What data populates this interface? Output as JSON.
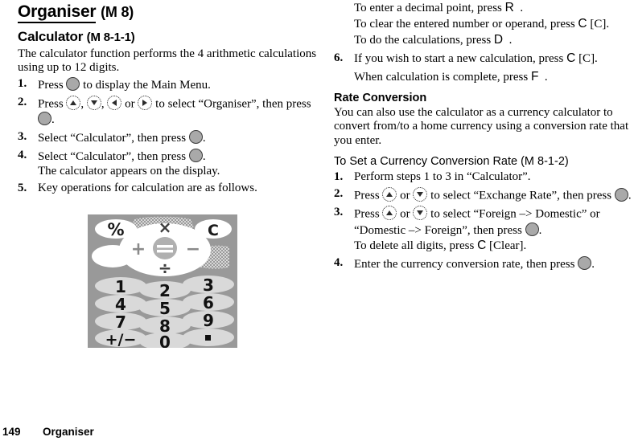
{
  "document": {
    "footer": {
      "page_number": "149",
      "section": "Organiser"
    }
  },
  "left_column": {
    "title": {
      "main": "Organiser",
      "code": "(M 8)"
    },
    "section": {
      "heading_main": "Calculator",
      "heading_code": "(M 8-1-1)",
      "intro": "The calculator function performs the 4 arithmetic calculations using up to 12 digits."
    },
    "steps": [
      {
        "number": "1.",
        "text_before": "Press",
        "key": "select-key",
        "text_after": "to display the Main Menu."
      },
      {
        "number": "2.",
        "text_before": "Press",
        "keys": [
          "up-key",
          "down-key",
          "left-key",
          "right-key"
        ],
        "separator_1": ",",
        "separator_2": ",",
        "separator_3": "or",
        "text_middle": "to select “Organiser”, then press",
        "key_end": "select-key",
        "text_end": "."
      },
      {
        "number": "3.",
        "text_before": "Select “Calculator”, then press",
        "key": "select-key",
        "text_after": "."
      },
      {
        "number": "4.",
        "text_before": "Select “Calculator”, then press",
        "key": "select-key",
        "text_after": ".",
        "sub_text": "The calculator appears on the display."
      },
      {
        "number": "5.",
        "text_before": "Key operations for calculation are as follows."
      }
    ],
    "figure": {
      "alt": "calculator-keypad-diagram",
      "background_color": "#999999",
      "key_color": "#d4d4d4",
      "dpad_color": "#ffffff",
      "hatch_color": "#c8c8c8",
      "keys_row_1": [
        "1",
        "2",
        "3"
      ],
      "keys_row_2": [
        "4",
        "5",
        "6"
      ],
      "keys_row_3": [
        "7",
        "8",
        "9"
      ],
      "keys_row_4": [
        "+/−",
        "0",
        "·"
      ],
      "soft_key_left": "%",
      "soft_key_right": "C",
      "dpad_up": "×",
      "dpad_left": "+",
      "dpad_center": "=",
      "dpad_right": "−",
      "dpad_down": "÷"
    }
  },
  "right_column": {
    "continued_substeps": [
      {
        "text_before": "To enter a decimal point, press",
        "key_letter": "R",
        "text_after": "."
      },
      {
        "text_before": "To clear the entered number or operand, press",
        "key_letter": "C",
        "text_after": "[C]."
      },
      {
        "text_before": "To do the calculations, press",
        "key_letter": "D",
        "text_after": "."
      }
    ],
    "step_6": {
      "number": "6.",
      "text_before": "If you wish to start a new calculation, press",
      "key_letter": "C",
      "text_after": "[C].",
      "sub_text_before": "When calculation is complete, press",
      "sub_key_letter": "F",
      "sub_text_after": "."
    },
    "rate_conversion": {
      "heading": "Rate Conversion",
      "intro": "You can also use the calculator as a currency calculator to convert from/to a home currency using a conversion rate that you enter.",
      "subheading": "To Set a Currency Conversion Rate (M 8-1-2)",
      "steps": [
        {
          "number": "1.",
          "text": "Perform steps 1 to 3 in “Calculator”."
        },
        {
          "number": "2.",
          "text_before": "Press",
          "key_a": "up-key",
          "text_or": "or",
          "key_b": "down-key",
          "text_middle": "to select “Exchange Rate”, then press",
          "key_end": "select-key",
          "text_end": "."
        },
        {
          "number": "3.",
          "text_before": "Press",
          "key_a": "up-key",
          "text_or": "or",
          "key_b": "down-key",
          "text_middle": "to select “Foreign –> Domestic” or “Domestic –> Foreign”, then press",
          "key_end": "select-key",
          "text_end": ".",
          "sub_text_before": "To delete all digits, press",
          "sub_key_letter": "C",
          "sub_text_after": "[Clear]."
        },
        {
          "number": "4.",
          "text_before": "Enter the currency conversion rate, then press",
          "key_end": "select-key",
          "text_end": "."
        }
      ]
    }
  }
}
